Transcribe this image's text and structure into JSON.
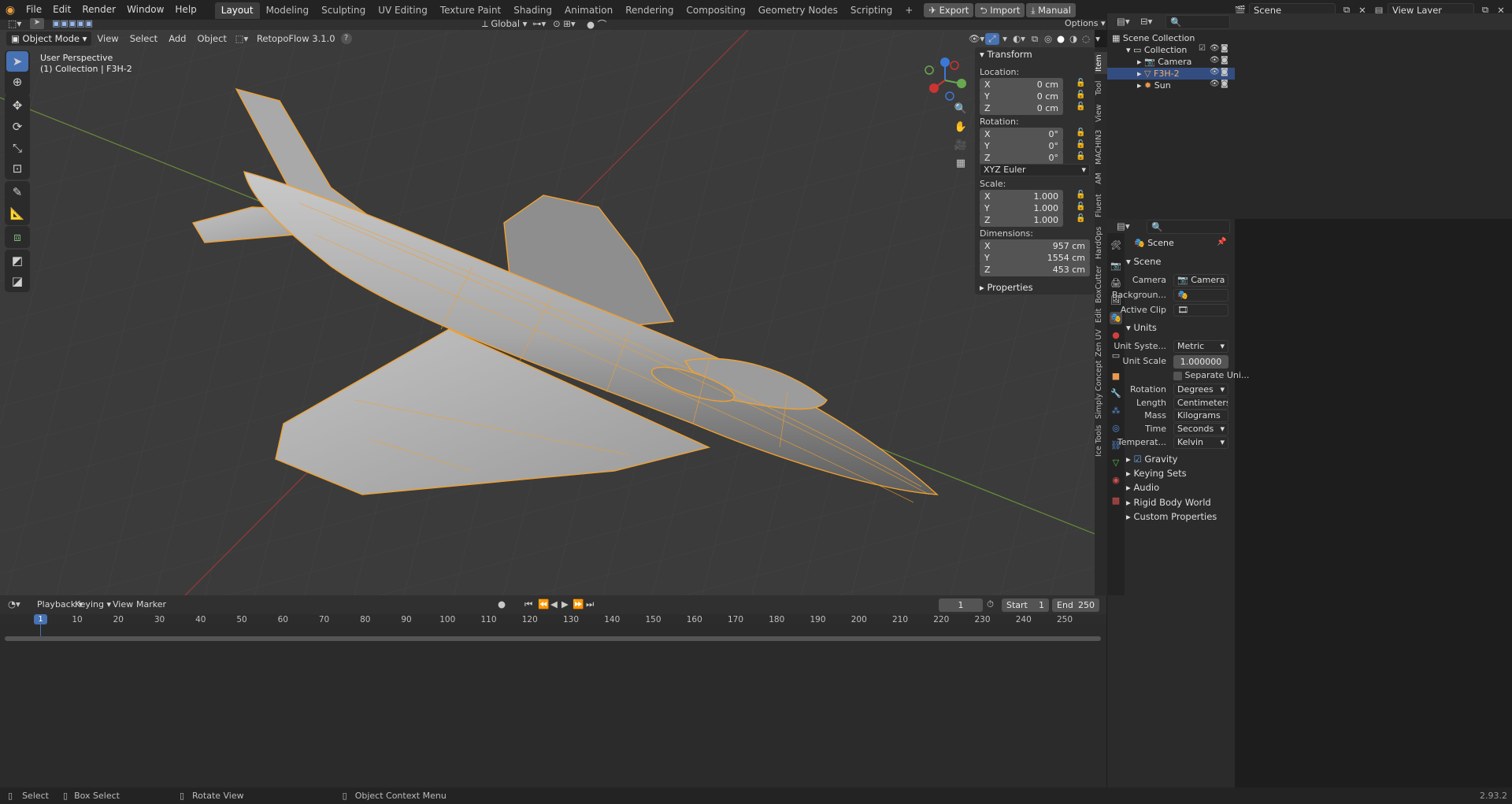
{
  "menus": [
    "File",
    "Edit",
    "Render",
    "Window",
    "Help"
  ],
  "workspaces": [
    "Layout",
    "Modeling",
    "Sculpting",
    "UV Editing",
    "Texture Paint",
    "Shading",
    "Animation",
    "Rendering",
    "Compositing",
    "Geometry Nodes",
    "Scripting"
  ],
  "topbar_right": {
    "export": "Export",
    "import": "Import",
    "manual": "Manual",
    "scene": "Scene",
    "view_layer": "View Layer"
  },
  "viewport_header": {
    "mode": "Object Mode",
    "menus": [
      "View",
      "Select",
      "Add",
      "Object"
    ],
    "addon": "RetopoFlow 3.1.0",
    "orientation": "Global",
    "options": "Options"
  },
  "viewport_info": {
    "perspective": "User Perspective",
    "collection": "(1) Collection | F3H-2"
  },
  "npanel": {
    "title": "Transform",
    "location_label": "Location:",
    "location": {
      "x": "0 cm",
      "y": "0 cm",
      "z": "0 cm"
    },
    "rotation_label": "Rotation:",
    "rotation": {
      "x": "0°",
      "y": "0°",
      "z": "0°"
    },
    "rotation_mode": "XYZ Euler",
    "scale_label": "Scale:",
    "scale": {
      "x": "1.000",
      "y": "1.000",
      "z": "1.000"
    },
    "dimensions_label": "Dimensions:",
    "dimensions": {
      "x": "957 cm",
      "y": "1554 cm",
      "z": "453 cm"
    },
    "axis": {
      "x": "X",
      "y": "Y",
      "z": "Z"
    },
    "properties": "Properties"
  },
  "side_tabs": [
    "Item",
    "Tool",
    "View",
    "MACHIN3",
    "AM",
    "Fluent",
    "HardOps",
    "BoxCutter",
    "Edit",
    "Zen UV",
    "Simply Concept",
    "Ice Tools"
  ],
  "outliner": {
    "root": "Scene Collection",
    "items": [
      "Collection",
      "Camera",
      "F3H-2",
      "Sun"
    ]
  },
  "properties": {
    "breadcrumb": "Scene",
    "scene_section": "Scene",
    "camera_label": "Camera",
    "camera_value": "Camera",
    "background_label": "Backgroun...",
    "active_clip_label": "Active Clip",
    "units_section": "Units",
    "unit_system_label": "Unit Syste...",
    "unit_system": "Metric",
    "unit_scale_label": "Unit Scale",
    "unit_scale": "1.000000",
    "separate_units": "Separate Uni...",
    "rotation_label": "Rotation",
    "rotation": "Degrees",
    "length_label": "Length",
    "length": "Centimeters",
    "mass_label": "Mass",
    "mass": "Kilograms",
    "time_label": "Time",
    "time": "Seconds",
    "temperature_label": "Temperat...",
    "temperature": "Kelvin",
    "sections": [
      "Gravity",
      "Keying Sets",
      "Audio",
      "Rigid Body World",
      "Custom Properties"
    ]
  },
  "timeline": {
    "menus": [
      "Playback",
      "Keying",
      "View",
      "Marker"
    ],
    "current_frame": "1",
    "start_label": "Start",
    "start": "1",
    "end_label": "End",
    "end": "250",
    "ticks": [
      "1",
      "10",
      "20",
      "30",
      "40",
      "50",
      "60",
      "70",
      "80",
      "90",
      "100",
      "110",
      "120",
      "130",
      "140",
      "150",
      "160",
      "170",
      "180",
      "190",
      "200",
      "210",
      "220",
      "230",
      "240",
      "250"
    ]
  },
  "statusbar": {
    "select": "Select",
    "box_select": "Box Select",
    "rotate_view": "Rotate View",
    "context_menu": "Object Context Menu",
    "version": "2.93.2"
  },
  "colors": {
    "accent": "#4772b3",
    "selection": "#f5a04a",
    "background": "#3b3b3b"
  }
}
